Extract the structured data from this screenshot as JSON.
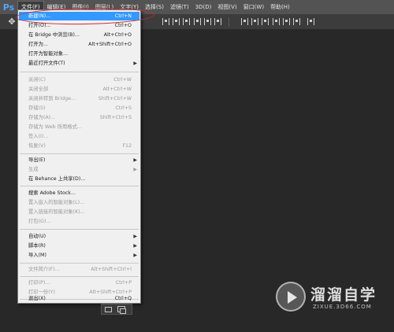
{
  "app": {
    "logo": "Ps"
  },
  "menubar": {
    "items": [
      {
        "label": "文件(F)"
      },
      {
        "label": "编辑(E)"
      },
      {
        "label": "图像(I)"
      },
      {
        "label": "图层(L)"
      },
      {
        "label": "文字(Y)"
      },
      {
        "label": "选择(S)"
      },
      {
        "label": "滤镜(T)"
      },
      {
        "label": "3D(D)"
      },
      {
        "label": "视图(V)"
      },
      {
        "label": "窗口(W)"
      },
      {
        "label": "帮助(H)"
      }
    ]
  },
  "options_bar": {
    "move_tool_icon": "move-icon"
  },
  "file_menu": {
    "items": [
      {
        "label": "新建(N)...",
        "shortcut": "Ctrl+N",
        "state": "highlighted"
      },
      {
        "label": "打开(O)...",
        "shortcut": "Ctrl+O"
      },
      {
        "label": "在 Bridge 中浏览(B)...",
        "shortcut": "Alt+Ctrl+O"
      },
      {
        "label": "打开为...",
        "shortcut": "Alt+Shift+Ctrl+O"
      },
      {
        "label": "打开为智能对象..."
      },
      {
        "label": "最近打开文件(T)",
        "submenu": true
      },
      {
        "label": "关闭(C)",
        "shortcut": "Ctrl+W",
        "state": "disabled"
      },
      {
        "label": "关闭全部",
        "shortcut": "Alt+Ctrl+W",
        "state": "disabled"
      },
      {
        "label": "关闭并转到 Bridge...",
        "shortcut": "Shift+Ctrl+W",
        "state": "disabled"
      },
      {
        "label": "存储(S)",
        "shortcut": "Ctrl+S",
        "state": "disabled"
      },
      {
        "label": "存储为(A)...",
        "shortcut": "Shift+Ctrl+S",
        "state": "disabled"
      },
      {
        "label": "存储为 Web 所用格式...",
        "state": "disabled"
      },
      {
        "label": "签入(I)...",
        "state": "disabled"
      },
      {
        "label": "恢复(V)",
        "shortcut": "F12",
        "state": "disabled"
      },
      {
        "label": "导出(E)",
        "submenu": true
      },
      {
        "label": "生成",
        "submenu": true,
        "state": "disabled"
      },
      {
        "label": "在 Behance 上共享(D)..."
      },
      {
        "label": "搜索 Adobe Stock..."
      },
      {
        "label": "置入嵌入的智能对象(L)...",
        "state": "disabled"
      },
      {
        "label": "置入链接的智能对象(K)...",
        "state": "disabled"
      },
      {
        "label": "打包(G)...",
        "state": "disabled"
      },
      {
        "label": "自动(U)",
        "submenu": true
      },
      {
        "label": "脚本(R)",
        "submenu": true
      },
      {
        "label": "导入(M)",
        "submenu": true
      },
      {
        "label": "文件简介(F)...",
        "shortcut": "Alt+Shift+Ctrl+I",
        "state": "disabled"
      },
      {
        "label": "打印(P)...",
        "shortcut": "Ctrl+P",
        "state": "disabled"
      },
      {
        "label": "打印一份(Y)",
        "shortcut": "Alt+Shift+Ctrl+P",
        "state": "disabled"
      },
      {
        "label": "退出(X)",
        "shortcut": "Ctrl+Q"
      }
    ]
  },
  "watermark": {
    "cn": "溜溜自学",
    "en": "ZIXUE.3D66.COM"
  },
  "colors": {
    "highlight": "#3399ff",
    "annotation_oval": "#d7262e",
    "ps_logo": "#4ea5ff"
  }
}
